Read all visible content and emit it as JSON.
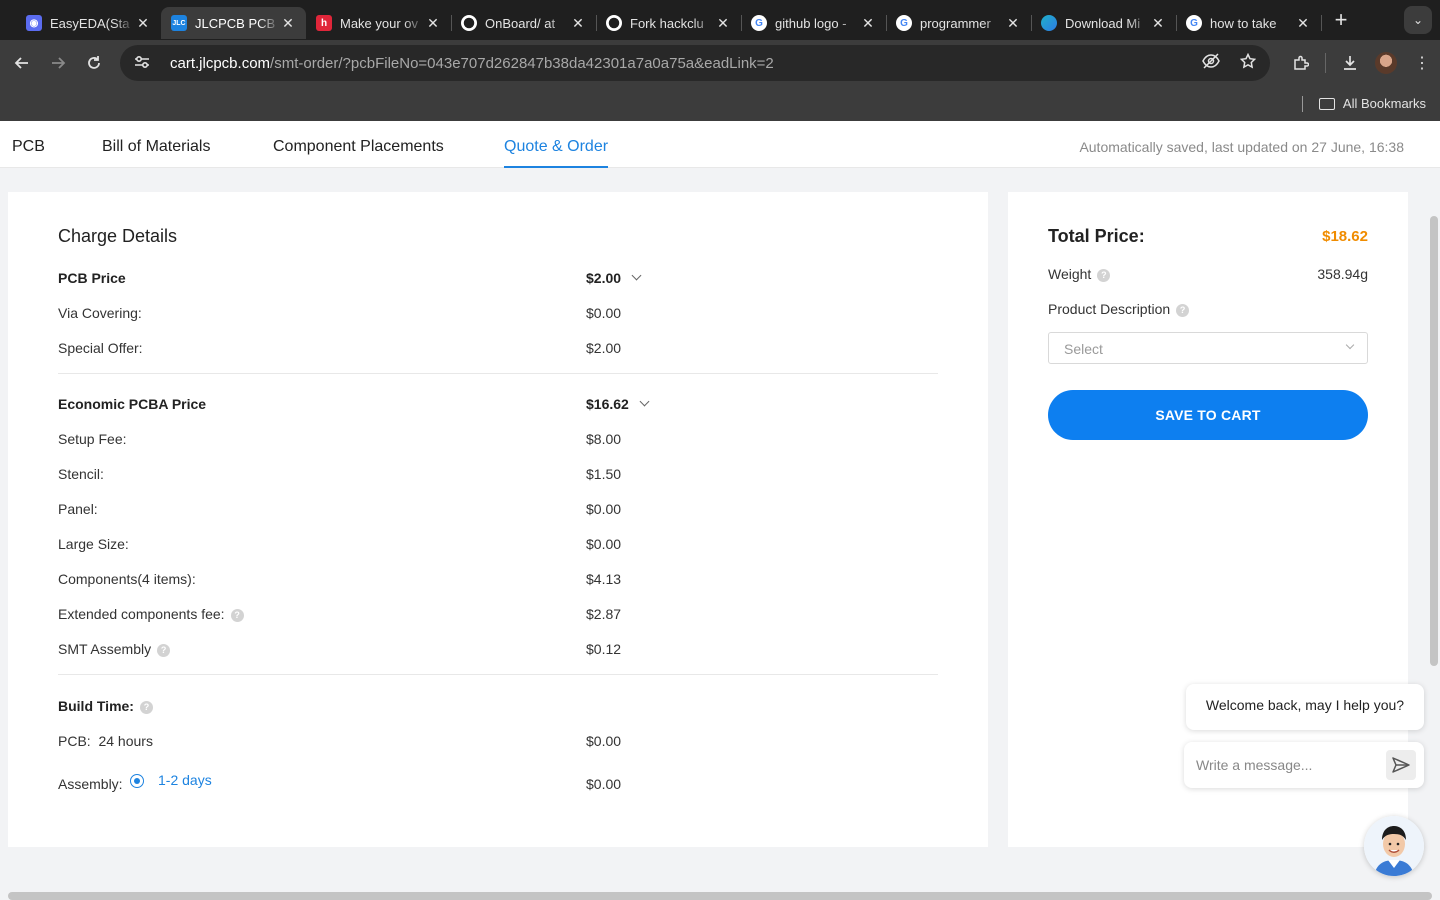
{
  "browser": {
    "tabs": [
      {
        "title": "EasyEDA(Sta",
        "favicon_color": "#5b6cf0",
        "favicon_glyph": "◉",
        "active": false
      },
      {
        "title": "JLCPCB PCB",
        "favicon_color": "#1d83e0",
        "favicon_glyph": "JLC",
        "active": true
      },
      {
        "title": "Make your ov",
        "favicon_color": "#e0263a",
        "favicon_glyph": "h",
        "active": false
      },
      {
        "title": "OnBoard/ at",
        "favicon_color": "#ffffff",
        "favicon_glyph": "github-icon",
        "active": false
      },
      {
        "title": "Fork hackclu",
        "favicon_color": "#ffffff",
        "favicon_glyph": "github-icon",
        "active": false
      },
      {
        "title": "github logo -",
        "favicon_color": "#ffffff",
        "favicon_glyph": "google-icon",
        "active": false
      },
      {
        "title": "programmer",
        "favicon_color": "#ffffff",
        "favicon_glyph": "google-icon",
        "active": false
      },
      {
        "title": "Download Mi",
        "favicon_color": "#1fb0c8",
        "favicon_glyph": "edge-icon",
        "active": false
      },
      {
        "title": "how to take",
        "favicon_color": "#ffffff",
        "favicon_glyph": "google-icon",
        "active": false
      }
    ],
    "url_host": "cart.jlcpcb.com",
    "url_rest": "/smt-order/?pcbFileNo=043e707d262847b38da42301a7a0a75a&eadLink=2",
    "bookmarks_label": "All Bookmarks"
  },
  "page": {
    "tabs": [
      "PCB",
      "Bill of Materials",
      "Component Placements",
      "Quote & Order"
    ],
    "active_tab": "Quote & Order",
    "autosave": "Automatically saved, last updated on 27 June, 16:38"
  },
  "charges": {
    "title": "Charge Details",
    "pcb_price": {
      "label": "PCB Price",
      "value": "$2.00"
    },
    "via_covering": {
      "label": "Via Covering:",
      "value": "$0.00"
    },
    "special_offer": {
      "label": "Special Offer:",
      "value": "$2.00"
    },
    "pcba_price": {
      "label": "Economic PCBA Price",
      "value": "$16.62"
    },
    "setup_fee": {
      "label": "Setup Fee:",
      "value": "$8.00"
    },
    "stencil": {
      "label": "Stencil:",
      "value": "$1.50"
    },
    "panel": {
      "label": "Panel:",
      "value": "$0.00"
    },
    "large_size": {
      "label": "Large Size:",
      "value": "$0.00"
    },
    "components": {
      "label": "Components(4 items):",
      "value": "$4.13"
    },
    "extended_fee": {
      "label": "Extended components fee:",
      "value": "$2.87"
    },
    "smt_assembly": {
      "label": "SMT Assembly",
      "value": "$0.12"
    },
    "build_time": {
      "label": "Build Time:"
    },
    "pcb_time": {
      "label": "PCB:",
      "time": "24 hours",
      "value": "$0.00"
    },
    "assembly_time": {
      "label": "Assembly:",
      "option": "1-2 days",
      "value": "$0.00"
    }
  },
  "summary": {
    "total_label": "Total Price:",
    "total_value": "$18.62",
    "total_color": "#f08c00",
    "weight_label": "Weight",
    "weight_value": "358.94g",
    "product_desc_label": "Product Description",
    "select_placeholder": "Select",
    "save_button": "SAVE TO CART",
    "accent": "#0d7ff0"
  },
  "chat": {
    "greeting": "Welcome back, may I help you?",
    "input_placeholder": "Write a message..."
  }
}
